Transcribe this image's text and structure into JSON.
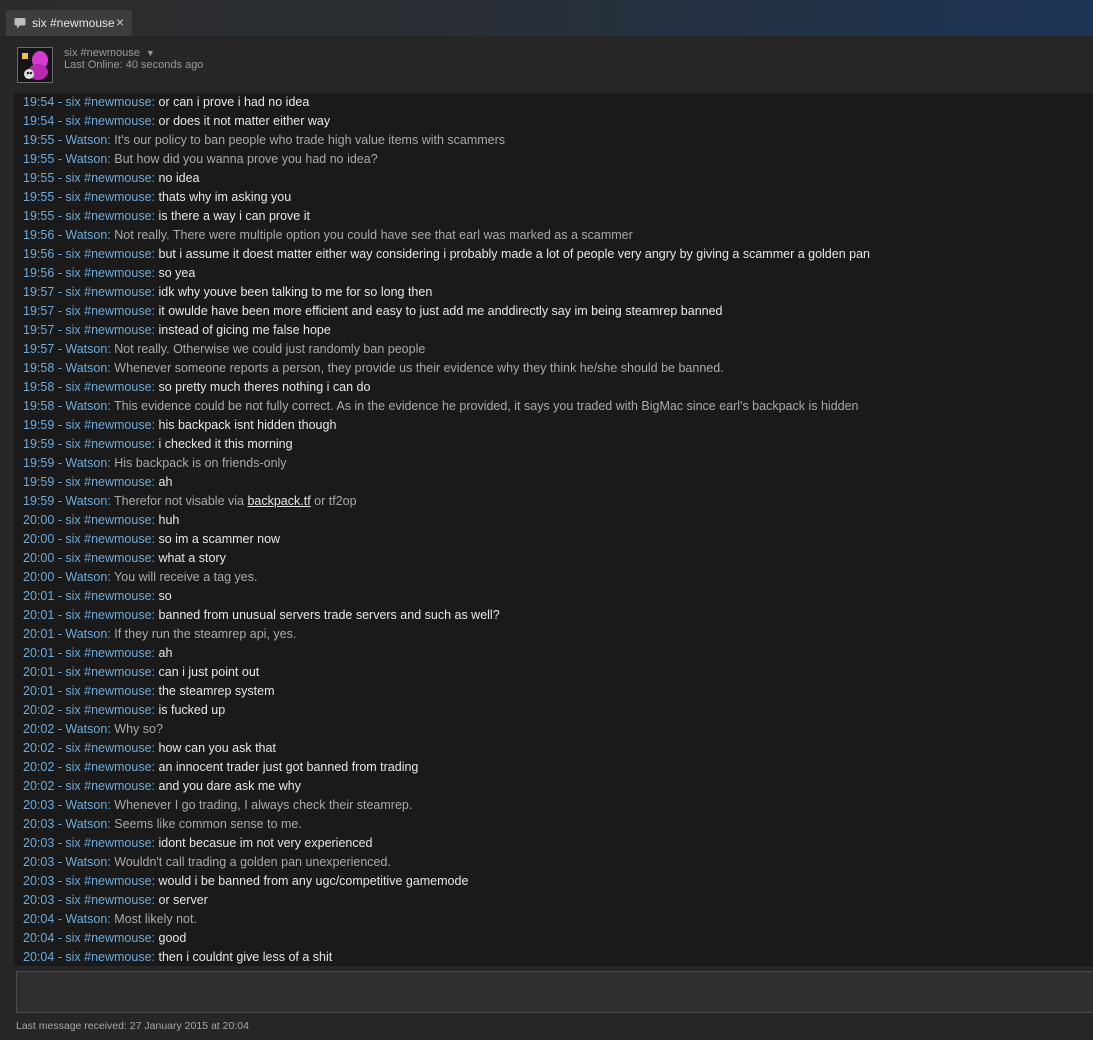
{
  "window": {
    "tab_title": "six #newmouse",
    "tab_close": "×"
  },
  "friend": {
    "name": "six #newmouse",
    "status": "Last Online: 40 seconds ago"
  },
  "colors": {
    "timestamp_name": "#6eaad8",
    "self_message": "#e6e6e6",
    "other_message": "#a9a9a9",
    "log_background": "#1a1a1a"
  },
  "messages": [
    {
      "time": "19:54",
      "sender": "six #newmouse",
      "text": "or can i prove i had no idea"
    },
    {
      "time": "19:54",
      "sender": "six #newmouse",
      "text": "or does it not matter either way"
    },
    {
      "time": "19:55",
      "sender": "Watson",
      "text": "It's our policy to ban people who trade high value items with scammers"
    },
    {
      "time": "19:55",
      "sender": "Watson",
      "text": "But how did you wanna prove you had no idea?"
    },
    {
      "time": "19:55",
      "sender": "six #newmouse",
      "text": "no idea"
    },
    {
      "time": "19:55",
      "sender": "six #newmouse",
      "text": "thats why im asking you"
    },
    {
      "time": "19:55",
      "sender": "six #newmouse",
      "text": "is there a way i can prove it"
    },
    {
      "time": "19:56",
      "sender": "Watson",
      "text": "Not really. There were multiple option you could have see that earl was marked as a scammer"
    },
    {
      "time": "19:56",
      "sender": "six #newmouse",
      "text": "but i assume it doest matter either way considering i probably made a lot of people very angry by giving a scammer a golden pan"
    },
    {
      "time": "19:56",
      "sender": "six #newmouse",
      "text": "so yea"
    },
    {
      "time": "19:57",
      "sender": "six #newmouse",
      "text": "idk why youve been talking to me for so long then"
    },
    {
      "time": "19:57",
      "sender": "six #newmouse",
      "text": "it owulde have been more efficient and easy to just add me anddirectly say im being steamrep banned"
    },
    {
      "time": "19:57",
      "sender": "six #newmouse",
      "text": "instead of gicing me false hope"
    },
    {
      "time": "19:57",
      "sender": "Watson",
      "text": "Not really. Otherwise we could just randomly ban people"
    },
    {
      "time": "19:58",
      "sender": "Watson",
      "text": "Whenever someone reports a person, they provide us their evidence why they think he/she should be banned."
    },
    {
      "time": "19:58",
      "sender": "six #newmouse",
      "text": "so pretty much theres nothing i can do"
    },
    {
      "time": "19:58",
      "sender": "Watson",
      "text": "This evidence could be not fully correct. As in the evidence he provided, it says you traded with BigMac since earl's backpack is hidden"
    },
    {
      "time": "19:59",
      "sender": "six #newmouse",
      "text": "his backpack isnt hidden though"
    },
    {
      "time": "19:59",
      "sender": "six #newmouse",
      "text": "i checked it this morning"
    },
    {
      "time": "19:59",
      "sender": "Watson",
      "text": "His backpack is on friends-only"
    },
    {
      "time": "19:59",
      "sender": "six #newmouse",
      "text": "ah"
    },
    {
      "time": "19:59",
      "sender": "Watson",
      "text": "Therefor not visable via ",
      "link": "backpack.tf",
      "after": " or tf2op"
    },
    {
      "time": "20:00",
      "sender": "six #newmouse",
      "text": "huh"
    },
    {
      "time": "20:00",
      "sender": "six #newmouse",
      "text": "so im a scammer now"
    },
    {
      "time": "20:00",
      "sender": "six #newmouse",
      "text": "what a story"
    },
    {
      "time": "20:00",
      "sender": "Watson",
      "text": "You will receive a tag yes."
    },
    {
      "time": "20:01",
      "sender": "six #newmouse",
      "text": "so"
    },
    {
      "time": "20:01",
      "sender": "six #newmouse",
      "text": "banned from unusual servers trade servers and such as well?"
    },
    {
      "time": "20:01",
      "sender": "Watson",
      "text": "If they run the steamrep api, yes."
    },
    {
      "time": "20:01",
      "sender": "six #newmouse",
      "text": "ah"
    },
    {
      "time": "20:01",
      "sender": "six #newmouse",
      "text": "can i just point out"
    },
    {
      "time": "20:01",
      "sender": "six #newmouse",
      "text": "the steamrep system"
    },
    {
      "time": "20:02",
      "sender": "six #newmouse",
      "text": "is fucked up"
    },
    {
      "time": "20:02",
      "sender": "Watson",
      "text": "Why so?"
    },
    {
      "time": "20:02",
      "sender": "six #newmouse",
      "text": "how can you ask that"
    },
    {
      "time": "20:02",
      "sender": "six #newmouse",
      "text": "an innocent trader just got banned from trading"
    },
    {
      "time": "20:02",
      "sender": "six #newmouse",
      "text": "and you dare ask me why"
    },
    {
      "time": "20:03",
      "sender": "Watson",
      "text": "Whenever I go trading, I always check their steamrep."
    },
    {
      "time": "20:03",
      "sender": "Watson",
      "text": "Seems like common sense to me."
    },
    {
      "time": "20:03",
      "sender": "six #newmouse",
      "text": "idont becasue im not very experienced"
    },
    {
      "time": "20:03",
      "sender": "Watson",
      "text": "Wouldn't call trading a golden pan unexperienced."
    },
    {
      "time": "20:03",
      "sender": "six #newmouse",
      "text": "would i be banned from any ugc/competitive gamemode"
    },
    {
      "time": "20:03",
      "sender": "six #newmouse",
      "text": "or server"
    },
    {
      "time": "20:04",
      "sender": "Watson",
      "text": "Most likely not."
    },
    {
      "time": "20:04",
      "sender": "six #newmouse",
      "text": "good"
    },
    {
      "time": "20:04",
      "sender": "six #newmouse",
      "text": "then i couldnt give less of a shit"
    }
  ],
  "footer": {
    "last_received": "Last message received: 27 January 2015 at 20:04"
  }
}
